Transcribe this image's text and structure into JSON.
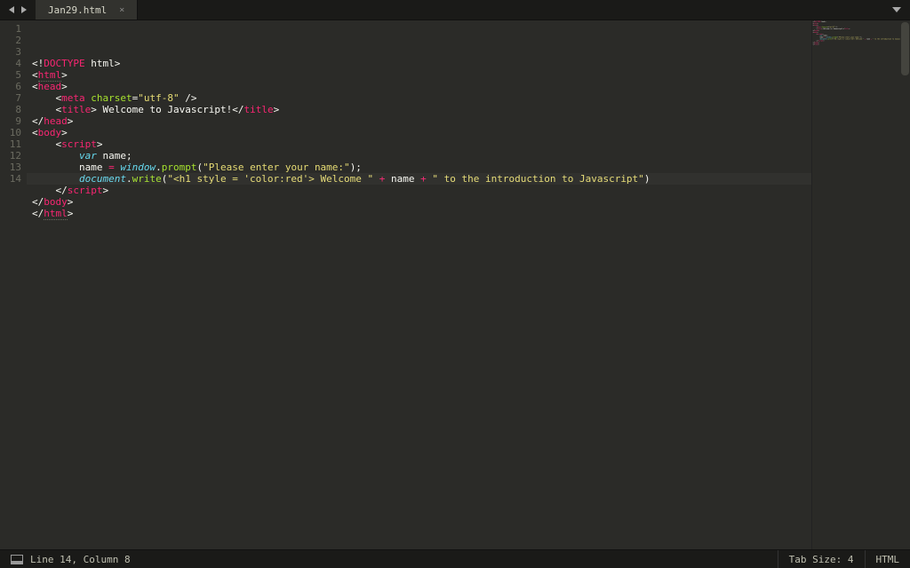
{
  "tab": {
    "title": "Jan29.html",
    "close_glyph": "×"
  },
  "code_lines": [
    [
      {
        "t": "<!",
        "c": "tk-punct"
      },
      {
        "t": "DOCTYPE",
        "c": "tk-tag"
      },
      {
        "t": " html",
        "c": "tk-text"
      },
      {
        "t": ">",
        "c": "tk-punct"
      }
    ],
    [
      {
        "t": "<",
        "c": "tk-punct"
      },
      {
        "t": "html",
        "c": "tk-tag tk-dotted"
      },
      {
        "t": ">",
        "c": "tk-punct"
      }
    ],
    [
      {
        "t": "<",
        "c": "tk-punct"
      },
      {
        "t": "head",
        "c": "tk-tag"
      },
      {
        "t": ">",
        "c": "tk-punct"
      }
    ],
    [
      {
        "t": "    ",
        "c": ""
      },
      {
        "t": "<",
        "c": "tk-punct"
      },
      {
        "t": "meta",
        "c": "tk-tag"
      },
      {
        "t": " ",
        "c": ""
      },
      {
        "t": "charset",
        "c": "tk-attr"
      },
      {
        "t": "=",
        "c": "tk-punct"
      },
      {
        "t": "\"utf-8\"",
        "c": "tk-str"
      },
      {
        "t": " />",
        "c": "tk-punct"
      }
    ],
    [
      {
        "t": "    ",
        "c": ""
      },
      {
        "t": "<",
        "c": "tk-punct"
      },
      {
        "t": "title",
        "c": "tk-tag"
      },
      {
        "t": ">",
        "c": "tk-punct"
      },
      {
        "t": " Welcome to Javascript!",
        "c": "tk-text"
      },
      {
        "t": "</",
        "c": "tk-punct"
      },
      {
        "t": "title",
        "c": "tk-tag"
      },
      {
        "t": ">",
        "c": "tk-punct"
      }
    ],
    [
      {
        "t": "</",
        "c": "tk-punct"
      },
      {
        "t": "head",
        "c": "tk-tag"
      },
      {
        "t": ">",
        "c": "tk-punct"
      }
    ],
    [
      {
        "t": "<",
        "c": "tk-punct"
      },
      {
        "t": "body",
        "c": "tk-tag"
      },
      {
        "t": ">",
        "c": "tk-punct"
      }
    ],
    [
      {
        "t": "    ",
        "c": ""
      },
      {
        "t": "<",
        "c": "tk-punct"
      },
      {
        "t": "script",
        "c": "tk-tag"
      },
      {
        "t": ">",
        "c": "tk-punct"
      }
    ],
    [
      {
        "t": "        ",
        "c": ""
      },
      {
        "t": "var",
        "c": "tk-storage"
      },
      {
        "t": " name;",
        "c": "tk-text"
      }
    ],
    [
      {
        "t": "        ",
        "c": ""
      },
      {
        "t": "name ",
        "c": "tk-text"
      },
      {
        "t": "=",
        "c": "tk-op"
      },
      {
        "t": " ",
        "c": ""
      },
      {
        "t": "window",
        "c": "tk-builtin"
      },
      {
        "t": ".",
        "c": "tk-punct"
      },
      {
        "t": "prompt",
        "c": "tk-func"
      },
      {
        "t": "(",
        "c": "tk-punct"
      },
      {
        "t": "\"Please enter your name:\"",
        "c": "tk-str"
      },
      {
        "t": ");",
        "c": "tk-punct"
      }
    ],
    [
      {
        "t": "        ",
        "c": ""
      },
      {
        "t": "document",
        "c": "tk-builtin"
      },
      {
        "t": ".",
        "c": "tk-punct"
      },
      {
        "t": "write",
        "c": "tk-func"
      },
      {
        "t": "(",
        "c": "tk-punct"
      },
      {
        "t": "\"<h1 style = 'color:red'> Welcome \"",
        "c": "tk-str"
      },
      {
        "t": " + ",
        "c": "tk-op"
      },
      {
        "t": "name",
        "c": "tk-text"
      },
      {
        "t": " + ",
        "c": "tk-op"
      },
      {
        "t": "\" to the introduction to Javascript\"",
        "c": "tk-str"
      },
      {
        "t": ")",
        "c": "tk-punct"
      }
    ],
    [
      {
        "t": "    ",
        "c": ""
      },
      {
        "t": "</",
        "c": "tk-punct"
      },
      {
        "t": "script",
        "c": "tk-tag"
      },
      {
        "t": ">",
        "c": "tk-punct"
      }
    ],
    [
      {
        "t": "</",
        "c": "tk-punct"
      },
      {
        "t": "body",
        "c": "tk-tag"
      },
      {
        "t": ">",
        "c": "tk-punct"
      }
    ],
    [
      {
        "t": "</",
        "c": "tk-punct"
      },
      {
        "t": "html",
        "c": "tk-tag tk-dotted"
      },
      {
        "t": ">",
        "c": "tk-punct"
      }
    ]
  ],
  "line_count": 14,
  "highlight_line": 14,
  "status": {
    "cursor": "Line 14, Column 8",
    "tab_size": "Tab Size: 4",
    "syntax": "HTML"
  }
}
